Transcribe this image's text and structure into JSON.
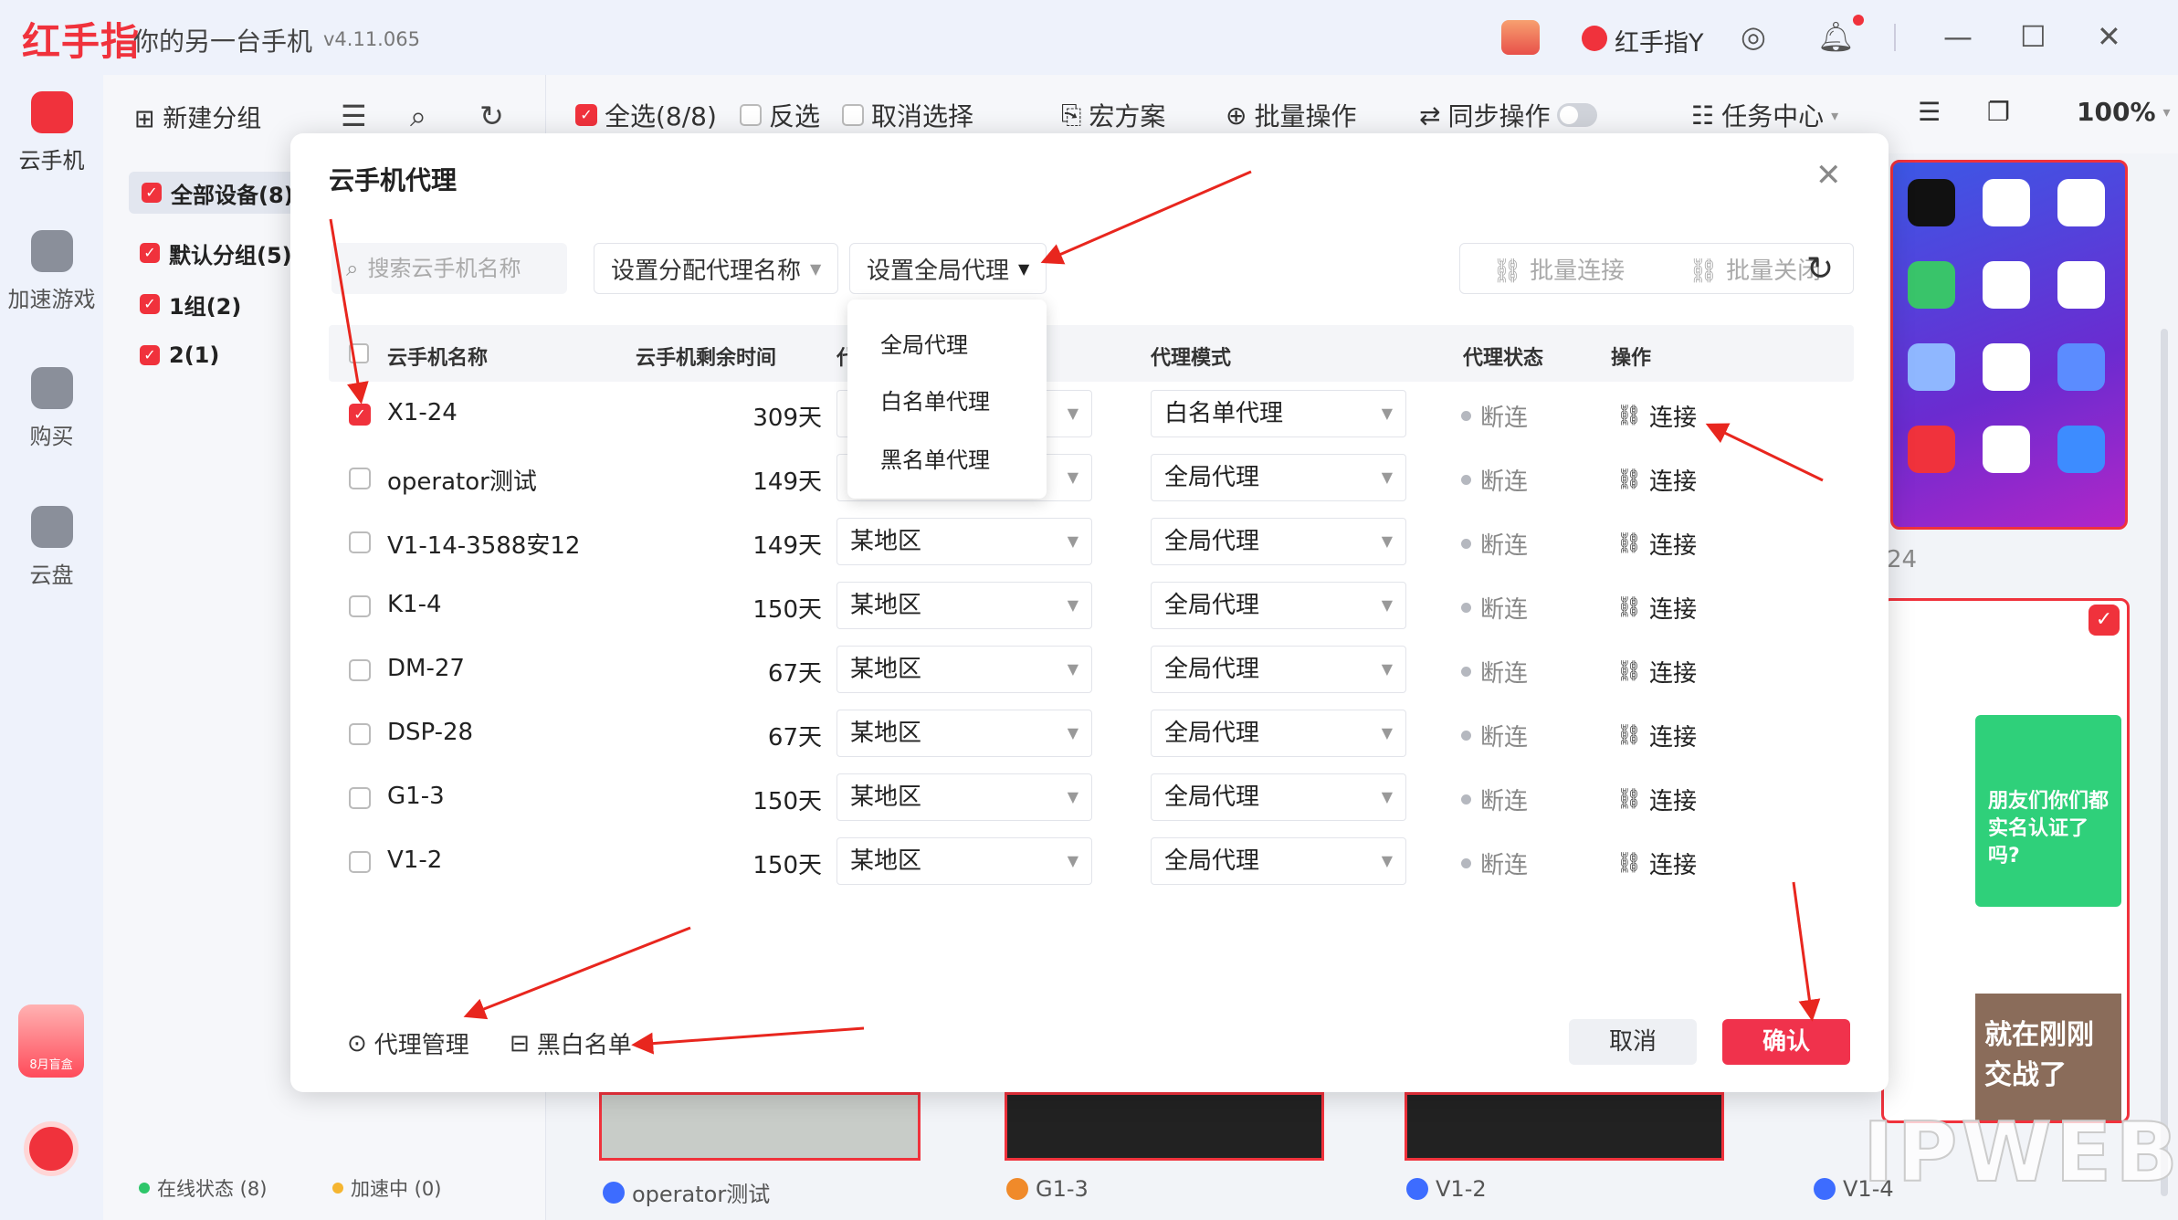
{
  "app": {
    "logo": "红手指",
    "tagline": "你的另一台手机",
    "version": "v4.11.065",
    "username": "红手指Y"
  },
  "nav": [
    {
      "label": "云手机"
    },
    {
      "label": "加速游戏"
    },
    {
      "label": "购买"
    },
    {
      "label": "云盘"
    }
  ],
  "promo_text": "8月盲盒",
  "group_toolbar": {
    "new_group": "新建分组"
  },
  "groups": [
    {
      "label": "全部设备(8)"
    },
    {
      "label": "默认分组(5)"
    },
    {
      "label": "1组(2)"
    },
    {
      "label": "2(1)"
    }
  ],
  "status": {
    "online": "在线状态 (8)",
    "accelerating": "加速中 (0)"
  },
  "toolbar": {
    "select_all": "全选(8/8)",
    "invert": "反选",
    "cancel_select": "取消选择",
    "macro": "宏方案",
    "batch": "批量操作",
    "sync": "同步操作",
    "task_center": "任务中心",
    "zoom": "100%"
  },
  "thumbnails": {
    "phone_side_num": "24",
    "green_card_text": "朋友们你们都实名认证了吗?",
    "red_card_text": "就在刚刚交战了",
    "labels": [
      "operator测试",
      "G1-3",
      "V1-2",
      "V1-4"
    ],
    "watermark": "IPWEB"
  },
  "modal": {
    "title": "云手机代理",
    "search_placeholder": "搜索云手机名称",
    "set_alloc": "设置分配代理名称",
    "set_global": "设置全局代理",
    "batch_connect": "批量连接",
    "batch_close": "批量关闭",
    "columns": {
      "name": "云手机名称",
      "remaining": "云手机剩余时间",
      "region": "代",
      "mode": "代理模式",
      "status": "代理状态",
      "op": "操作"
    },
    "dropdown": [
      "全局代理",
      "白名单代理",
      "黑名单代理"
    ],
    "rows": [
      {
        "name": "X1-24",
        "days": "309天",
        "region": "",
        "mode": "白名单代理",
        "status": "断连",
        "op": "连接"
      },
      {
        "name": "operator测试",
        "days": "149天",
        "region": "",
        "mode": "全局代理",
        "status": "断连",
        "op": "连接"
      },
      {
        "name": "V1-14-3588安12",
        "days": "149天",
        "region": "某地区",
        "mode": "全局代理",
        "status": "断连",
        "op": "连接"
      },
      {
        "name": "K1-4",
        "days": "150天",
        "region": "某地区",
        "mode": "全局代理",
        "status": "断连",
        "op": "连接"
      },
      {
        "name": "DM-27",
        "days": "67天",
        "region": "某地区",
        "mode": "全局代理",
        "status": "断连",
        "op": "连接"
      },
      {
        "name": "DSP-28",
        "days": "67天",
        "region": "某地区",
        "mode": "全局代理",
        "status": "断连",
        "op": "连接"
      },
      {
        "name": "G1-3",
        "days": "150天",
        "region": "某地区",
        "mode": "全局代理",
        "status": "断连",
        "op": "连接"
      },
      {
        "name": "V1-2",
        "days": "150天",
        "region": "某地区",
        "mode": "全局代理",
        "status": "断连",
        "op": "连接"
      }
    ],
    "footer": {
      "proxy_manage": "代理管理",
      "blackwhite": "黑白名单",
      "cancel": "取消",
      "confirm": "确认"
    }
  },
  "colors": {
    "brand_red": "#f0323c",
    "confirm_red": "#f0324c",
    "annotation_red": "#e8261e"
  },
  "icons": [
    "search-icon",
    "refresh-icon",
    "link-icon",
    "settings-icon",
    "bell-icon",
    "close-icon",
    "checkbox-checked-icon"
  ]
}
